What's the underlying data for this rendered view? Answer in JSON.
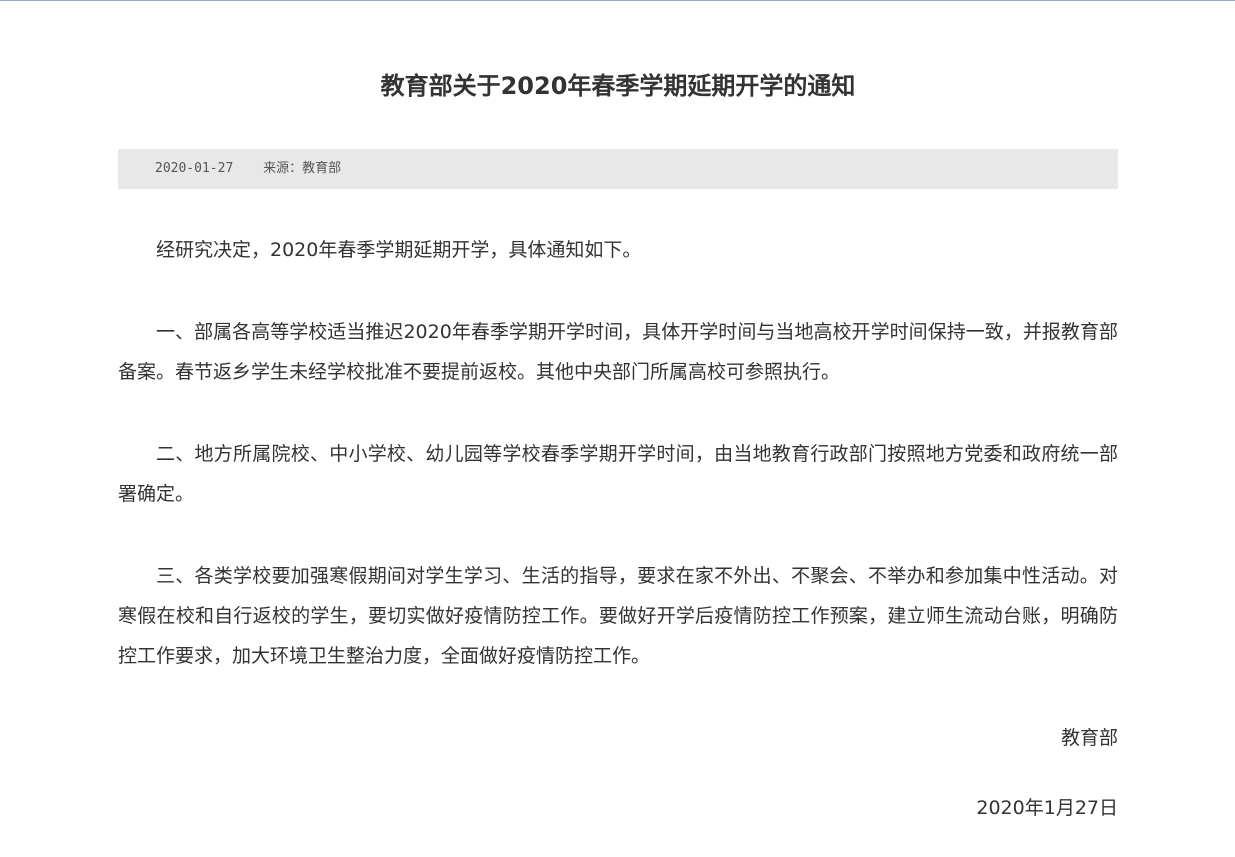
{
  "article": {
    "title": "教育部关于2020年春季学期延期开学的通知",
    "meta": {
      "date": "2020-01-27",
      "source": "来源：教育部"
    },
    "paragraphs": [
      "经研究决定，2020年春季学期延期开学，具体通知如下。",
      "一、部属各高等学校适当推迟2020年春季学期开学时间，具体开学时间与当地高校开学时间保持一致，并报教育部备案。春节返乡学生未经学校批准不要提前返校。其他中央部门所属高校可参照执行。",
      "二、地方所属院校、中小学校、幼儿园等学校春季学期开学时间，由当地教育行政部门按照地方党委和政府统一部署确定。",
      "三、各类学校要加强寒假期间对学生学习、生活的指导，要求在家不外出、不聚会、不举办和参加集中性活动。对寒假在校和自行返校的学生，要切实做好疫情防控工作。要做好开学后疫情防控工作预案，建立师生流动台账，明确防控工作要求，加大环境卫生整治力度，全面做好疫情防控工作。"
    ],
    "signature": {
      "org": "教育部",
      "date": "2020年1月27日"
    }
  },
  "colors": {
    "text": "#333333",
    "meta_bar_bg": "#e8e8e8",
    "top_border": "#8fa8c8"
  }
}
